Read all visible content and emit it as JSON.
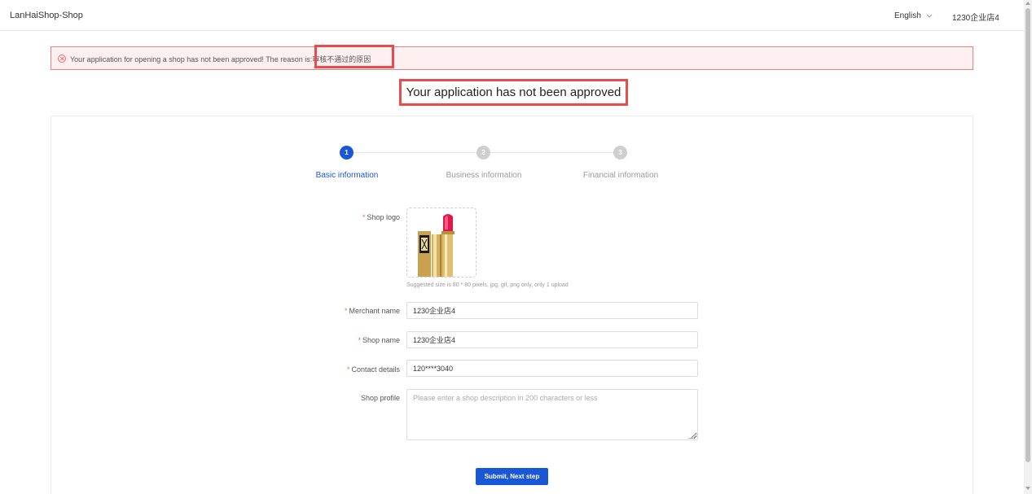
{
  "header": {
    "brand": "LanHaiShop-Shop",
    "language": "English",
    "user": "1230企业店4"
  },
  "alert": {
    "message": "Your application for opening a shop has not been approved! The reason is:审核不通过的原因"
  },
  "status_title": "Your application has not been approved",
  "steps": [
    {
      "number": "1",
      "label": "Basic information",
      "state": "active"
    },
    {
      "number": "2",
      "label": "Business information",
      "state": "inactive"
    },
    {
      "number": "3",
      "label": "Financial information",
      "state": "inactive"
    }
  ],
  "form": {
    "shop_logo_label": "Shop logo",
    "logo_hint": "Suggested size is 80 * 80 pixels, jpg, gif, png only, only 1 upload",
    "merchant_name_label": "Merchant name",
    "merchant_name_value": "1230企业店4",
    "shop_name_label": "Shop name",
    "shop_name_value": "1230企业店4",
    "contact_label": "Contact details",
    "contact_value": "120****3040",
    "profile_label": "Shop profile",
    "profile_placeholder": "Please enter a shop description in 200 characters or less",
    "required_mark": "*"
  },
  "submit_label": "Submit, Next step",
  "colors": {
    "primary": "#1a57d6",
    "error": "#f56c6c",
    "highlight": "#e74c4c"
  }
}
